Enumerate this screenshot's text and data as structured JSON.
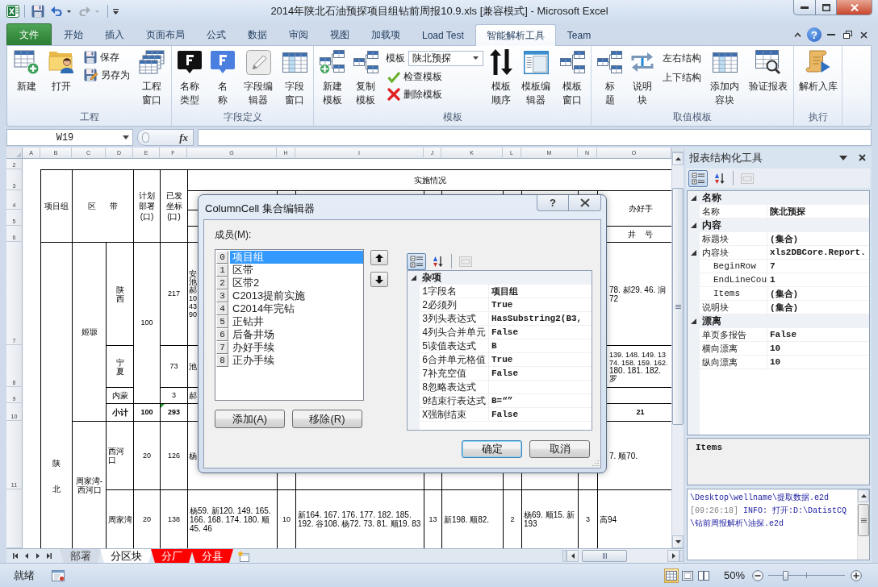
{
  "window": {
    "title": "2014年陕北石油预探项目组钻前周报10.9.xls [兼容模式] - Microsoft Excel"
  },
  "quick_access": [
    {
      "disabled": false
    },
    {
      "disabled": false
    },
    {
      "disabled": true
    }
  ],
  "ribbon": {
    "tabs": [
      {
        "label": "文件",
        "kind": "file",
        "selected": false
      },
      {
        "label": "开始",
        "kind": "tab",
        "selected": false
      },
      {
        "label": "插入",
        "kind": "tab",
        "selected": false
      },
      {
        "label": "页面布局",
        "kind": "tab",
        "selected": false
      },
      {
        "label": "公式",
        "kind": "tab",
        "selected": false
      },
      {
        "label": "数据",
        "kind": "tab",
        "selected": false
      },
      {
        "label": "审阅",
        "kind": "tab",
        "selected": false
      },
      {
        "label": "视图",
        "kind": "tab",
        "selected": false
      },
      {
        "label": "加载项",
        "kind": "tab",
        "selected": false
      },
      {
        "label": "Load Test",
        "kind": "tab",
        "selected": false
      },
      {
        "label": "智能解析工具",
        "kind": "tab",
        "selected": true
      },
      {
        "label": "Team",
        "kind": "tab",
        "selected": false
      }
    ],
    "help_button": "?",
    "groups": [
      {
        "label": "工程",
        "items": [
          {
            "kind": "large",
            "label": "新建"
          },
          {
            "kind": "large",
            "label": "打开"
          },
          {
            "kind": "small_stack",
            "items": [
              {
                "label": "保存"
              },
              {
                "label": "另存为"
              }
            ]
          },
          {
            "kind": "large",
            "label": "工程窗口"
          }
        ]
      },
      {
        "label": "字段定义",
        "items": [
          {
            "kind": "large",
            "label": "名称类型"
          },
          {
            "kind": "large",
            "label": "名称"
          },
          {
            "kind": "large",
            "label": "字段编辑器"
          },
          {
            "kind": "large",
            "label": "字段窗口"
          }
        ]
      },
      {
        "label": "模板",
        "items": [
          {
            "kind": "large",
            "label": "新建模板"
          },
          {
            "kind": "large",
            "label": "复制模板"
          },
          {
            "kind": "combo_stack",
            "combo_label": "模板",
            "combo_value": "陕北预探",
            "items": [
              {
                "label": "检查模板"
              },
              {
                "label": "删除模板"
              }
            ]
          },
          {
            "kind": "large",
            "label": "模板顺序"
          },
          {
            "kind": "large",
            "label": "模板编辑器"
          },
          {
            "kind": "large",
            "label": "模板窗口"
          }
        ]
      },
      {
        "label": "取值模板",
        "items": [
          {
            "kind": "large",
            "label": "标题"
          },
          {
            "kind": "large",
            "label": "说明块"
          },
          {
            "kind": "text_stack",
            "items": [
              {
                "label": "左右结构"
              },
              {
                "label": "上下结构"
              }
            ]
          },
          {
            "kind": "large",
            "label": "添加内容块"
          },
          {
            "kind": "large",
            "label": "验证报表"
          }
        ]
      },
      {
        "label": "执行",
        "items": [
          {
            "kind": "large",
            "label": "解析入库"
          }
        ]
      }
    ]
  },
  "formula_bar": {
    "name_box": "W19",
    "function_button": "fx"
  },
  "sheet": {
    "column_headers": [
      "A",
      "B",
      "C",
      "D",
      "E",
      "F",
      "G",
      "H",
      "I",
      "J",
      "K",
      "L",
      "M",
      "N",
      "O"
    ],
    "row_headers": [
      "2",
      "3",
      "4",
      "5",
      "6",
      "7",
      "8",
      "9",
      "10",
      "11"
    ],
    "cells": [
      {
        "kind": "data",
        "text": "项目组"
      },
      {
        "kind": "data",
        "text": "区 带"
      },
      {
        "kind": "data",
        "text": "计划部署(口)"
      },
      {
        "kind": "data",
        "text": "已发坐标(口)"
      },
      {
        "kind": "data",
        "text": "实施情况"
      },
      {
        "kind": "data",
        "text": "办好手"
      },
      {
        "kind": "data",
        "text": "井 号"
      },
      {
        "kind": "data",
        "text": "陕北"
      },
      {
        "kind": "data",
        "text": "姬塬"
      },
      {
        "kind": "data",
        "text": "陕西"
      },
      {
        "kind": "data",
        "text": "宁夏"
      },
      {
        "kind": "data",
        "text": "内蒙"
      },
      {
        "kind": "total",
        "text": "小计"
      },
      {
        "kind": "data",
        "text": "100"
      },
      {
        "kind": "total",
        "text": "100"
      },
      {
        "kind": "data",
        "text": "217"
      },
      {
        "kind": "data",
        "text": "73"
      },
      {
        "kind": "data",
        "text": "3"
      },
      {
        "kind": "total",
        "text": "293"
      },
      {
        "kind": "data",
        "lines": [
          "安",
          "池",
          "郝",
          "10",
          "43",
          "90"
        ]
      },
      {
        "kind": "data",
        "text": "池"
      },
      {
        "kind": "data",
        "text": "郝"
      },
      {
        "kind": "data",
        "text": "78. 郝29. 46. 润72"
      },
      {
        "kind": "data",
        "lines": [
          "139. 148. 149. 13",
          "74. 158. 159. 162.",
          "180. 181. 182. 罗"
        ]
      },
      {
        "kind": "total",
        "text": "21"
      },
      {
        "kind": "data",
        "text": "周家湾-西河口"
      },
      {
        "kind": "data",
        "text": "西河口"
      },
      {
        "kind": "data",
        "text": "20"
      },
      {
        "kind": "data",
        "text": "126"
      },
      {
        "kind": "data",
        "text": "杨"
      },
      {
        "kind": "data",
        "text": "7. 顺70."
      },
      {
        "kind": "data",
        "text": "周家湾"
      },
      {
        "kind": "data",
        "text": "20"
      },
      {
        "kind": "data",
        "text": "138"
      },
      {
        "kind": "data",
        "text": "杨59. 新120. 149. 165. 166. 168. 174. 180. 顺45. 46"
      },
      {
        "kind": "data",
        "text": "10"
      },
      {
        "kind": "data",
        "text": "新164. 167. 176. 177. 182. 185. 192. 谷108. 杨72. 73. 81. 顺19. 83"
      },
      {
        "kind": "data",
        "text": "13"
      },
      {
        "kind": "data",
        "text": "新198. 顺82."
      },
      {
        "kind": "data",
        "text": "2"
      },
      {
        "kind": "data",
        "text": "杨69. 顺15. 新193"
      },
      {
        "kind": "data",
        "text": "3"
      },
      {
        "kind": "data",
        "text": "高94"
      }
    ]
  },
  "sheet_tabs": [
    {
      "label": "部署",
      "selected": false
    },
    {
      "label": "分区块",
      "selected": true
    },
    {
      "label": "分厂",
      "selected": false,
      "color": "#ff0000"
    },
    {
      "label": "分县",
      "selected": false,
      "color": "#ff0000"
    }
  ],
  "status_bar": {
    "status": "就绪",
    "views": [
      {
        "selected": true
      },
      {
        "selected": false
      },
      {
        "selected": false
      }
    ],
    "zoom": "50%",
    "zoom_slider": {
      "level": 0.22
    }
  },
  "dialog": {
    "title": "ColumnCell 集合编辑器",
    "help_button": "?",
    "members_label": "成员(M):",
    "members": [
      {
        "index": "0",
        "name": "项目组",
        "selected": true
      },
      {
        "index": "1",
        "name": "区带",
        "selected": false
      },
      {
        "index": "2",
        "name": "区带2",
        "selected": false
      },
      {
        "index": "3",
        "name": "C2013提前实施",
        "selected": false
      },
      {
        "index": "4",
        "name": "C2014年完钻",
        "selected": false
      },
      {
        "index": "5",
        "name": "正钻井",
        "selected": false
      },
      {
        "index": "6",
        "name": "后备井场",
        "selected": false
      },
      {
        "index": "7",
        "name": "办好手续",
        "selected": false
      },
      {
        "index": "8",
        "name": "正办手续",
        "selected": false
      }
    ],
    "add_button": "添加(A)",
    "remove_button": "移除(R)",
    "toolbar": [
      {
        "selected": true,
        "disabled": false
      },
      {
        "selected": false,
        "disabled": false
      },
      {
        "selected": false,
        "disabled": true
      }
    ],
    "property_grid": {
      "categories": [
        {
          "name": "杂项",
          "expanded": true,
          "properties": [
            {
              "name": "1字段名",
              "value": "项目组"
            },
            {
              "name": "2必须列",
              "value": "True"
            },
            {
              "name": "3列头表达式",
              "value": "HasSubstring2(B3,"
            },
            {
              "name": "4列头合并单元",
              "value": "False"
            },
            {
              "name": "5读值表达式",
              "value": "B"
            },
            {
              "name": "6合并单元格值",
              "value": "True"
            },
            {
              "name": "7补充空值",
              "value": "False"
            },
            {
              "name": "8忽略表达式"
            },
            {
              "name": "9结束行表达式",
              "value": "B=“”"
            },
            {
              "name": "X强制结束",
              "value": "False"
            }
          ]
        }
      ]
    },
    "ok_button": "确定",
    "cancel_button": "取消"
  },
  "panel": {
    "title": "报表结构化工具",
    "toolbar": [
      {
        "selected": true,
        "disabled": false
      },
      {
        "selected": false,
        "disabled": false
      },
      {
        "selected": false,
        "disabled": true
      }
    ],
    "property_grid": {
      "categories": [
        {
          "name": "名称",
          "expanded": true,
          "properties": [
            {
              "name": "名称",
              "value": "陕北预探"
            }
          ]
        },
        {
          "name": "内容",
          "expanded": true,
          "properties": [
            {
              "name": "标题块",
              "value": "(集合)"
            },
            {
              "name": "内容块",
              "value": "xls2DBCore.Report.",
              "expanded": true,
              "children": [
                {
                  "name": "BeginRow",
                  "value": "7"
                },
                {
                  "name": "EndLineCou",
                  "value": "1"
                },
                {
                  "name": "Items",
                  "value": "(集合)"
                }
              ]
            },
            {
              "name": "说明块",
              "value": "(集合)"
            }
          ]
        },
        {
          "name": "漂离",
          "expanded": true,
          "properties": [
            {
              "name": "单页多报告",
              "value": "False"
            },
            {
              "name": "横向漂离",
              "value": "10"
            },
            {
              "name": "纵向漂离",
              "value": "10"
            }
          ]
        }
      ]
    },
    "description": "Items",
    "log": [
      {
        "text": "\\Desktop\\wellname\\提取数据.e2d"
      },
      {
        "time": "[09:26:18]",
        "text": "INFO: 打开:D:\\DatistCQ"
      },
      {
        "text": "\\钻前周报解析\\油探.e2d"
      }
    ]
  }
}
